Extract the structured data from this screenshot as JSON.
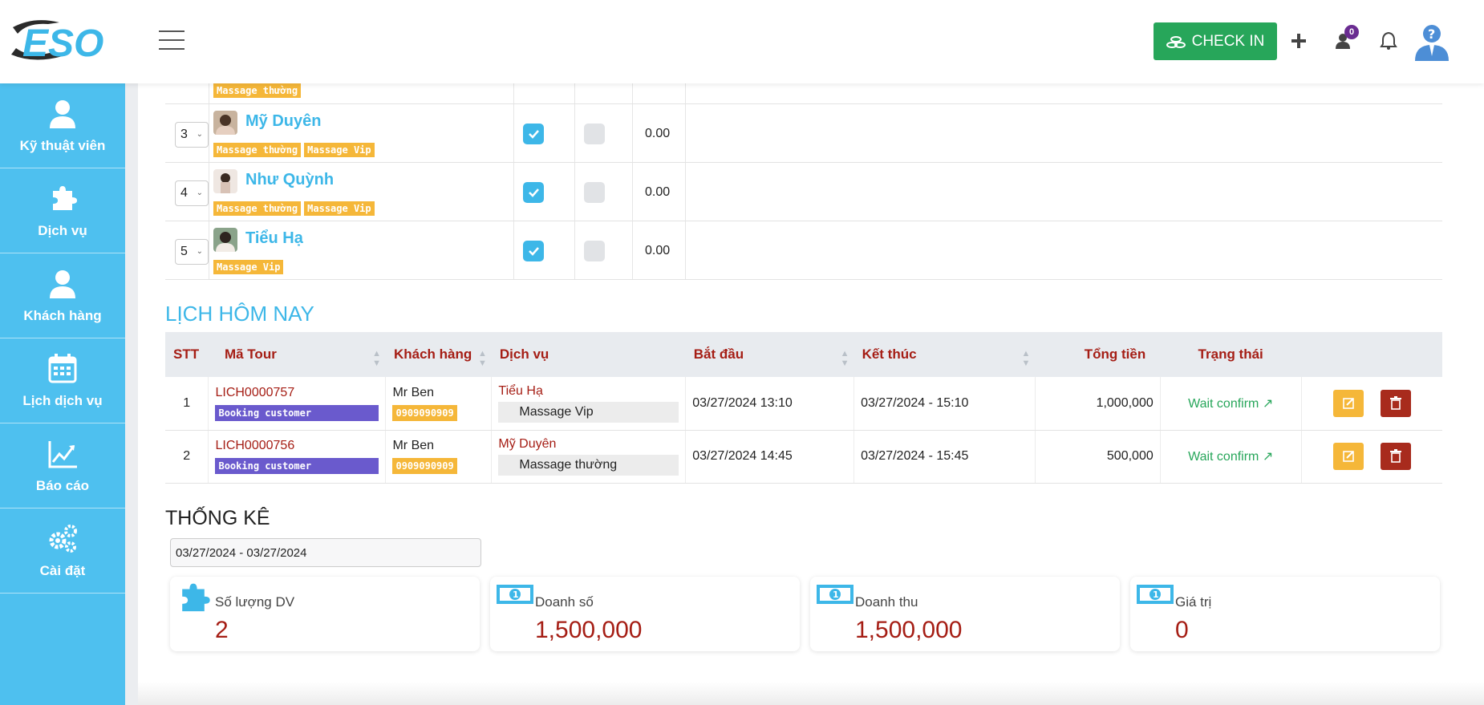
{
  "header": {
    "logo_text": "ESO",
    "checkin_label": "CHECK IN",
    "notification_count": "0"
  },
  "sidebar": {
    "items": [
      {
        "label": "Kỹ thuật viên",
        "icon": "user-icon"
      },
      {
        "label": "Dịch vụ",
        "icon": "puzzle-icon"
      },
      {
        "label": "Khách hàng",
        "icon": "user-icon"
      },
      {
        "label": "Lịch dịch vụ",
        "icon": "calendar-icon"
      },
      {
        "label": "Báo cáo",
        "icon": "chart-line-icon"
      },
      {
        "label": "Cài đặt",
        "icon": "gears-icon"
      }
    ]
  },
  "technicians": {
    "partial_row_tag": "Massage thường",
    "rows": [
      {
        "order": "3",
        "name": "Mỹ Duyên",
        "tags": [
          "Massage thường",
          "Massage Vip"
        ],
        "checked": true,
        "second_checked": false,
        "value": "0.00"
      },
      {
        "order": "4",
        "name": "Như Quỳnh",
        "tags": [
          "Massage thường",
          "Massage Vip"
        ],
        "checked": true,
        "second_checked": false,
        "value": "0.00"
      },
      {
        "order": "5",
        "name": "Tiểu Hạ",
        "tags": [
          "Massage Vip"
        ],
        "checked": true,
        "second_checked": false,
        "value": "0.00"
      }
    ]
  },
  "today": {
    "title": "LỊCH HÔM NAY",
    "columns": [
      "STT",
      "Mã Tour",
      "Khách hàng",
      "Dịch vụ",
      "Bắt đầu",
      "Kết thúc",
      "Tổng tiền",
      "Trạng thái"
    ],
    "rows": [
      {
        "stt": "1",
        "code": "LICH0000757",
        "code_tag": "Booking customer",
        "customer": "Mr Ben",
        "phone": "0909090909",
        "staff": "Tiểu Hạ",
        "service": "Massage Vip",
        "start": "03/27/2024 13:10",
        "end": "03/27/2024 - 15:10",
        "total": "1,000,000",
        "status": "Wait confirm"
      },
      {
        "stt": "2",
        "code": "LICH0000756",
        "code_tag": "Booking customer",
        "customer": "Mr Ben",
        "phone": "0909090909",
        "staff": "Mỹ Duyên",
        "service": "Massage thường",
        "start": "03/27/2024 14:45",
        "end": "03/27/2024 - 15:45",
        "total": "500,000",
        "status": "Wait confirm"
      }
    ]
  },
  "stats": {
    "title": "THỐNG KÊ",
    "date_range": "03/27/2024 - 03/27/2024",
    "cards": [
      {
        "label": "Số lượng DV",
        "value": "2",
        "icon": "puzzle-icon"
      },
      {
        "label": "Doanh số",
        "value": "1,500,000",
        "icon": "money-icon"
      },
      {
        "label": "Doanh thu",
        "value": "1,500,000",
        "icon": "money-icon"
      },
      {
        "label": "Giá trị",
        "value": "0",
        "icon": "money-icon"
      }
    ]
  },
  "colors": {
    "sidebar": "#4ec0ef",
    "accent": "#3db7e8",
    "checkin": "#27a65a",
    "danger_text": "#a51d14"
  }
}
